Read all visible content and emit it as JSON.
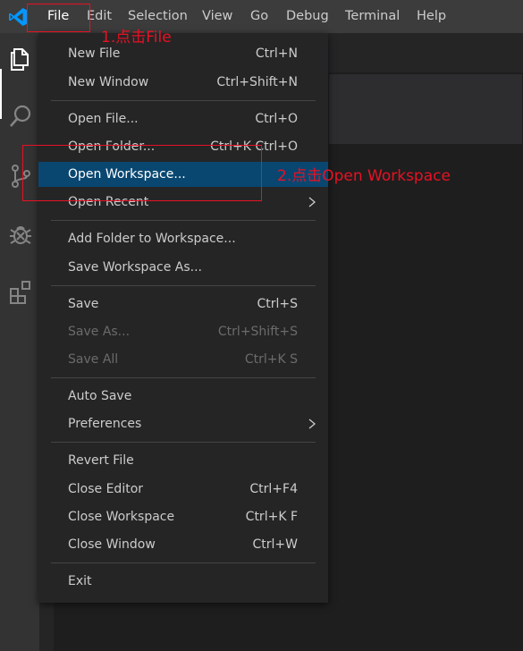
{
  "menubar": {
    "items": [
      {
        "label": "File"
      },
      {
        "label": "Edit"
      },
      {
        "label": "Selection"
      },
      {
        "label": "View"
      },
      {
        "label": "Go"
      },
      {
        "label": "Debug"
      },
      {
        "label": "Terminal"
      },
      {
        "label": "Help"
      }
    ]
  },
  "file_menu": {
    "items": [
      {
        "label": "New File",
        "shortcut": "Ctrl+N"
      },
      {
        "label": "New Window",
        "shortcut": "Ctrl+Shift+N"
      },
      {
        "label": "Open File...",
        "shortcut": "Ctrl+O"
      },
      {
        "label": "Open Folder...",
        "shortcut": "Ctrl+K Ctrl+O"
      },
      {
        "label": "Open Workspace...",
        "shortcut": ""
      },
      {
        "label": "Open Recent",
        "shortcut": ""
      },
      {
        "label": "Add Folder to Workspace...",
        "shortcut": ""
      },
      {
        "label": "Save Workspace As...",
        "shortcut": ""
      },
      {
        "label": "Save",
        "shortcut": "Ctrl+S"
      },
      {
        "label": "Save As...",
        "shortcut": "Ctrl+Shift+S"
      },
      {
        "label": "Save All",
        "shortcut": "Ctrl+K S"
      },
      {
        "label": "Auto Save",
        "shortcut": ""
      },
      {
        "label": "Preferences",
        "shortcut": ""
      },
      {
        "label": "Revert File",
        "shortcut": ""
      },
      {
        "label": "Close Editor",
        "shortcut": "Ctrl+F4"
      },
      {
        "label": "Close Workspace",
        "shortcut": "Ctrl+K F"
      },
      {
        "label": "Close Window",
        "shortcut": "Ctrl+W"
      },
      {
        "label": "Exit",
        "shortcut": ""
      }
    ]
  },
  "activity_icons": [
    "explorer-icon",
    "search-icon",
    "source-control-icon",
    "debug-icon",
    "extensions-icon"
  ],
  "annotations": {
    "step1": "1.点击File",
    "step2": "2.点击Open Workspace"
  },
  "colors": {
    "accent_highlight": "#094771",
    "annotation_red": "#e81123",
    "vscode_blue": "#0098ff"
  }
}
